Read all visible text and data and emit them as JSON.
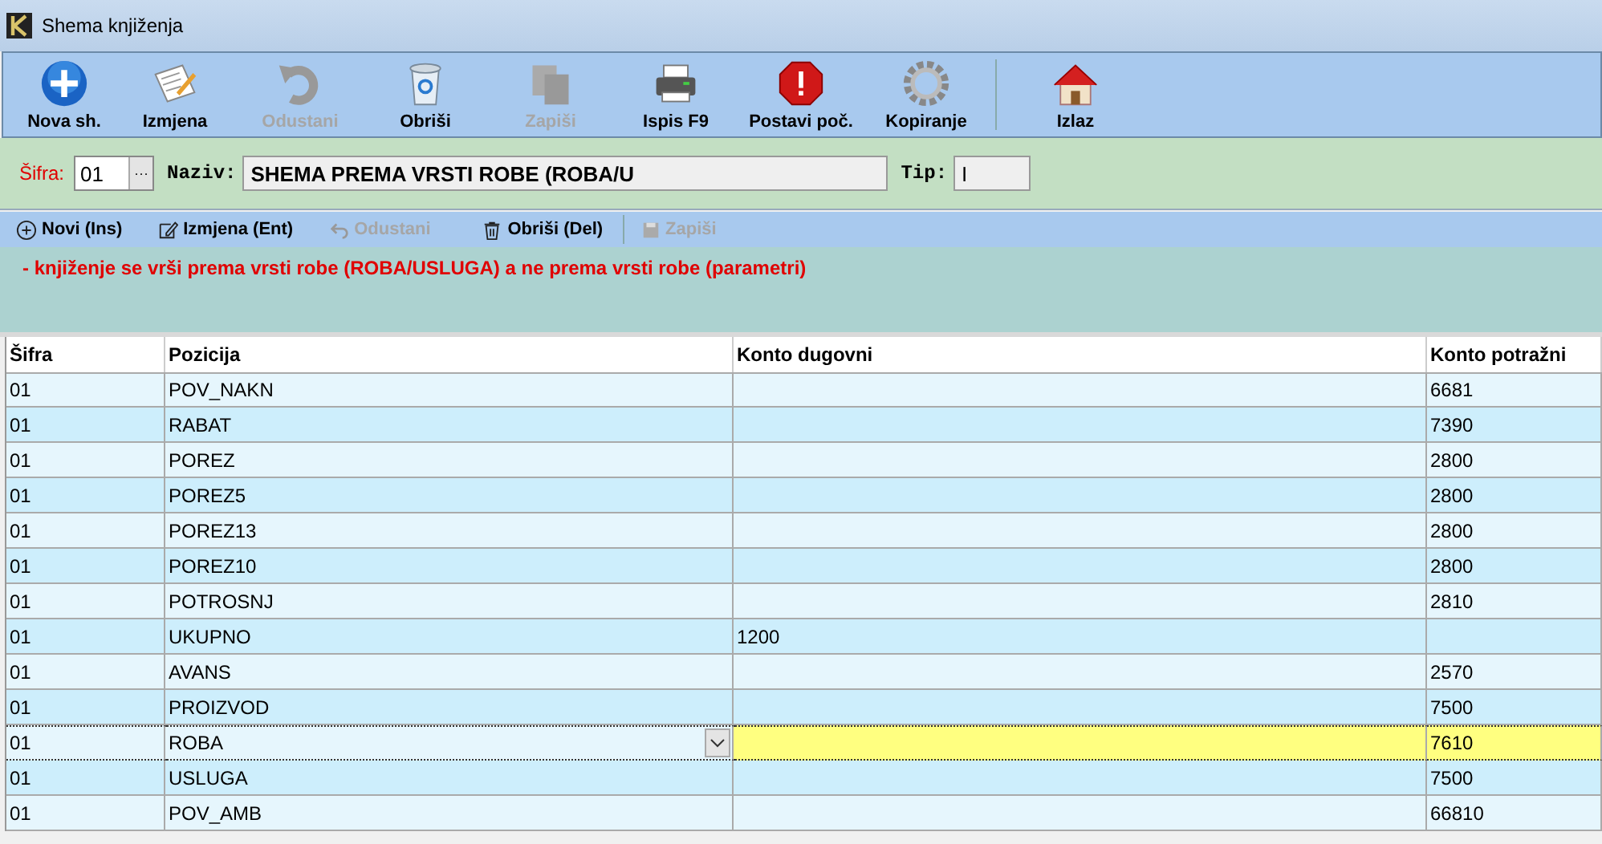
{
  "window": {
    "title": "Shema knjiženja"
  },
  "toolbar": [
    {
      "label": "Nova sh.",
      "kind": "add",
      "disabled": false
    },
    {
      "label": "Izmjena",
      "kind": "edit",
      "disabled": false
    },
    {
      "label": "Odustani",
      "kind": "undo",
      "disabled": true
    },
    {
      "label": "Obriši",
      "kind": "trash",
      "disabled": false
    },
    {
      "label": "Zapiši",
      "kind": "save",
      "disabled": true
    },
    {
      "label": "Ispis F9",
      "kind": "print",
      "disabled": false
    },
    {
      "label": "Postavi poč.",
      "kind": "stop",
      "disabled": false
    },
    {
      "label": "Kopiranje",
      "kind": "gear",
      "disabled": false
    },
    {
      "label": "Izlaz",
      "kind": "home",
      "disabled": false
    }
  ],
  "form": {
    "sifra_label": "Šifra:",
    "sifra": "01",
    "browse": "···",
    "naziv_label": "Naziv:",
    "naziv": "SHEMA PREMA VRSTI ROBE (ROBA/U",
    "tip_label": "Tip:",
    "tip": "I"
  },
  "subtoolbar": [
    {
      "label": "Novi (Ins)",
      "kind": "add",
      "disabled": false
    },
    {
      "label": "Izmjena (Ent)",
      "kind": "edit",
      "disabled": false
    },
    {
      "label": "Odustani",
      "kind": "undo",
      "disabled": true
    },
    {
      "label": "Obriši (Del)",
      "kind": "trash",
      "disabled": false
    },
    {
      "label": "Zapiši",
      "kind": "save",
      "disabled": true
    }
  ],
  "note": "- knjiženje se vrši prema vrsti robe (ROBA/USLUGA) a ne prema vrsti robe (parametri)",
  "table": {
    "columns": [
      "Šifra",
      "Pozicija",
      "Konto dugovni",
      "Konto potražni"
    ],
    "rows": [
      {
        "cells": [
          "01",
          "POV_NAKN",
          "",
          "6681"
        ],
        "selected": false
      },
      {
        "cells": [
          "01",
          "RABAT",
          "",
          "7390"
        ],
        "selected": false
      },
      {
        "cells": [
          "01",
          "POREZ",
          "",
          "2800"
        ],
        "selected": false
      },
      {
        "cells": [
          "01",
          "POREZ5",
          "",
          "2800"
        ],
        "selected": false
      },
      {
        "cells": [
          "01",
          "POREZ13",
          "",
          "2800"
        ],
        "selected": false
      },
      {
        "cells": [
          "01",
          "POREZ10",
          "",
          "2800"
        ],
        "selected": false
      },
      {
        "cells": [
          "01",
          "POTROSNJ",
          "",
          "2810"
        ],
        "selected": false
      },
      {
        "cells": [
          "01",
          "UKUPNO",
          "1200",
          ""
        ],
        "selected": false
      },
      {
        "cells": [
          "01",
          "AVANS",
          "",
          "2570"
        ],
        "selected": false
      },
      {
        "cells": [
          "01",
          "PROIZVOD",
          "",
          "7500"
        ],
        "selected": false
      },
      {
        "cells": [
          "01",
          "ROBA",
          "",
          "7610"
        ],
        "selected": true
      },
      {
        "cells": [
          "01",
          "USLUGA",
          "",
          "7500"
        ],
        "selected": false
      },
      {
        "cells": [
          "01",
          "POV_AMB",
          "",
          "66810"
        ],
        "selected": false
      }
    ]
  }
}
